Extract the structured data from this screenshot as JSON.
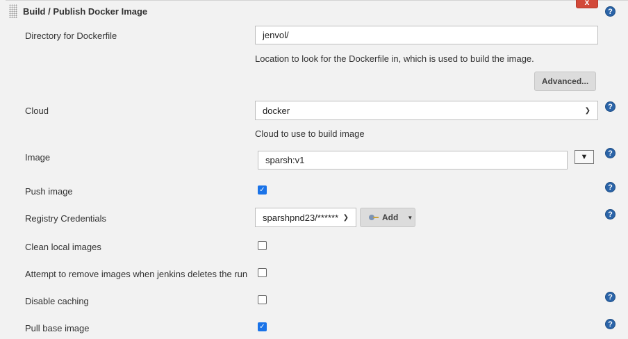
{
  "section": {
    "title": "Build / Publish Docker Image",
    "delete_label": "x"
  },
  "help_label": "?",
  "dockerfile": {
    "label": "Directory for Dockerfile",
    "value": "jenvol/",
    "description": "Location to look for the Dockerfile in, which is used to build the image.",
    "advanced_label": "Advanced..."
  },
  "cloud": {
    "label": "Cloud",
    "selected": "docker",
    "description": "Cloud to use to build image"
  },
  "image": {
    "label": "Image",
    "value": "sparsh:v1",
    "toggle_label": "▼"
  },
  "push_image": {
    "label": "Push image",
    "checked": true
  },
  "registry_credentials": {
    "label": "Registry Credentials",
    "selected": "sparshpnd23/******",
    "add_label": "Add"
  },
  "clean_local_images": {
    "label": "Clean local images",
    "checked": false
  },
  "remove_images": {
    "label": "Attempt to remove images when jenkins deletes the run",
    "checked": false
  },
  "disable_caching": {
    "label": "Disable caching",
    "checked": false
  },
  "pull_base_image": {
    "label": "Pull base image",
    "checked": true
  },
  "colors": {
    "delete_red": "#d24939",
    "help_blue": "#2b64a8",
    "checkbox_blue": "#1a73e8",
    "panel_bg": "#f2f2f2"
  }
}
